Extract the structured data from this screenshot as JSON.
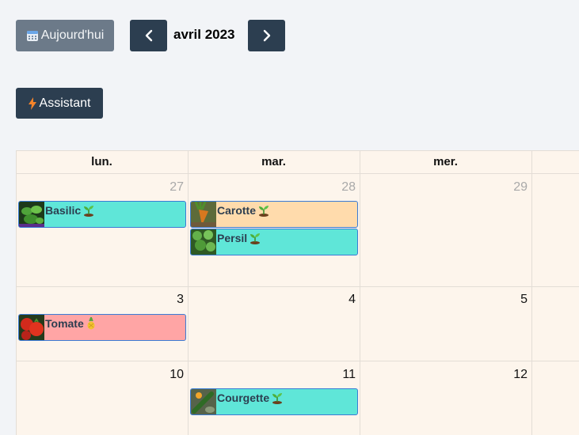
{
  "toolbar": {
    "today_label": "Aujourd'hui",
    "month_title": "avril 2023",
    "assistant_label": "Assistant"
  },
  "calendar": {
    "weekdays": [
      "lun.",
      "mar.",
      "mer."
    ],
    "weeks": [
      {
        "days": [
          {
            "num": "27",
            "other": true
          },
          {
            "num": "28",
            "other": true
          },
          {
            "num": "29",
            "other": true
          }
        ]
      },
      {
        "days": [
          {
            "num": "3",
            "other": false
          },
          {
            "num": "4",
            "other": false
          },
          {
            "num": "5",
            "other": false
          }
        ]
      },
      {
        "days": [
          {
            "num": "10",
            "other": false
          },
          {
            "num": "11",
            "other": false
          },
          {
            "num": "12",
            "other": false
          }
        ]
      }
    ],
    "events": [
      {
        "title": "Basilic",
        "icon": "sprout-icon",
        "color": "#5fe6d8"
      },
      {
        "title": "Carotte",
        "icon": "sprout-icon",
        "color": "#ffdbac"
      },
      {
        "title": "Persil",
        "icon": "sprout-icon",
        "color": "#5fe6d8"
      },
      {
        "title": "Tomate",
        "icon": "pineapple-icon",
        "color": "#ffa5a5"
      },
      {
        "title": "Courgette",
        "icon": "sprout-icon",
        "color": "#5fe6d8"
      }
    ]
  },
  "colors": {
    "primary_button": "#2c3e50",
    "secondary_button": "#6c7a89",
    "calendar_bg": "#fdf5ec"
  }
}
